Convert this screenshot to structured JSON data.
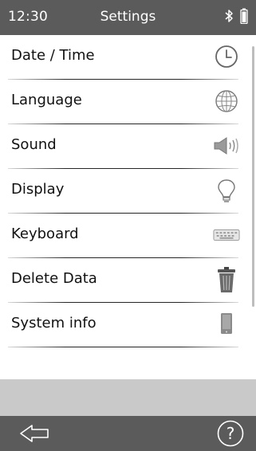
{
  "status": {
    "time": "12:30",
    "title": "Settings",
    "icons": [
      "bluetooth-icon",
      "battery-icon"
    ]
  },
  "settings": {
    "items": [
      {
        "label": "Date / Time",
        "icon": "clock-icon"
      },
      {
        "label": "Language",
        "icon": "globe-icon"
      },
      {
        "label": "Sound",
        "icon": "speaker-icon"
      },
      {
        "label": "Display",
        "icon": "lightbulb-icon"
      },
      {
        "label": "Keyboard",
        "icon": "keyboard-icon"
      },
      {
        "label": "Delete Data",
        "icon": "trash-icon"
      },
      {
        "label": "System info",
        "icon": "device-icon"
      }
    ]
  },
  "bottom": {
    "back_icon": "back-arrow-icon",
    "help_icon": "help-icon"
  },
  "colors": {
    "bar": "#5b5b5b",
    "band": "#c9c9c9",
    "background": "#ffffff",
    "text": "#111111"
  }
}
